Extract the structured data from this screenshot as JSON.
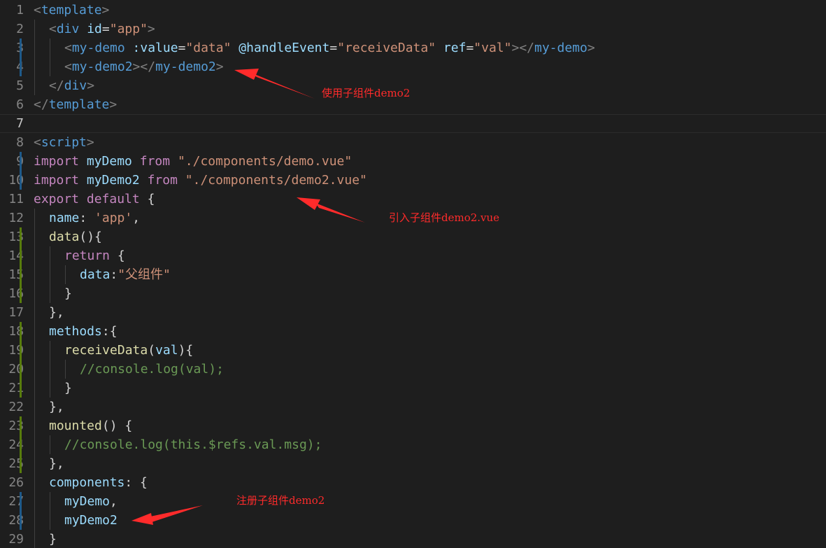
{
  "editor": {
    "background": "#1e1e1e",
    "lines": [
      {
        "n": "1",
        "indent": 0,
        "tokens": [
          [
            "t-punc",
            "<"
          ],
          [
            "t-tag",
            "template"
          ],
          [
            "t-punc",
            ">"
          ]
        ]
      },
      {
        "n": "2",
        "indent": 1,
        "tokens": [
          [
            "t-punc",
            "<"
          ],
          [
            "t-tag",
            "div"
          ],
          [
            "t-txt",
            " "
          ],
          [
            "t-attr",
            "id"
          ],
          [
            "t-txt",
            "="
          ],
          [
            "t-str",
            "\"app\""
          ],
          [
            "t-punc",
            ">"
          ]
        ]
      },
      {
        "n": "3",
        "indent": 2,
        "mark": "#1e5a8a",
        "tokens": [
          [
            "t-punc",
            "<"
          ],
          [
            "t-tag",
            "my-demo"
          ],
          [
            "t-txt",
            " "
          ],
          [
            "t-attr",
            ":value"
          ],
          [
            "t-txt",
            "="
          ],
          [
            "t-str",
            "\"data\""
          ],
          [
            "t-txt",
            " "
          ],
          [
            "t-attr",
            "@handleEvent"
          ],
          [
            "t-txt",
            "="
          ],
          [
            "t-str",
            "\"receiveData\""
          ],
          [
            "t-txt",
            " "
          ],
          [
            "t-attr",
            "ref"
          ],
          [
            "t-txt",
            "="
          ],
          [
            "t-str",
            "\"val\""
          ],
          [
            "t-punc",
            ">"
          ],
          [
            "t-punc",
            "</"
          ],
          [
            "t-tag",
            "my-demo"
          ],
          [
            "t-punc",
            ">"
          ]
        ]
      },
      {
        "n": "4",
        "indent": 2,
        "mark": "#1e5a8a",
        "tokens": [
          [
            "t-punc",
            "<"
          ],
          [
            "t-tag",
            "my-demo2"
          ],
          [
            "t-punc",
            ">"
          ],
          [
            "t-punc",
            "</"
          ],
          [
            "t-tag",
            "my-demo2"
          ],
          [
            "t-punc",
            ">"
          ]
        ]
      },
      {
        "n": "5",
        "indent": 1,
        "tokens": [
          [
            "t-punc",
            "</"
          ],
          [
            "t-tag",
            "div"
          ],
          [
            "t-punc",
            ">"
          ]
        ]
      },
      {
        "n": "6",
        "indent": 0,
        "tokens": [
          [
            "t-punc",
            "</"
          ],
          [
            "t-tag",
            "template"
          ],
          [
            "t-punc",
            ">"
          ]
        ]
      },
      {
        "n": "7",
        "indent": 0,
        "current": true,
        "tokens": []
      },
      {
        "n": "8",
        "indent": 0,
        "tokens": [
          [
            "t-punc",
            "<"
          ],
          [
            "t-tag",
            "script"
          ],
          [
            "t-punc",
            ">"
          ]
        ]
      },
      {
        "n": "9",
        "indent": 0,
        "mark": "#1e5a8a",
        "tokens": [
          [
            "t-key",
            "import"
          ],
          [
            "t-txt",
            " "
          ],
          [
            "t-var",
            "myDemo"
          ],
          [
            "t-txt",
            " "
          ],
          [
            "t-key",
            "from"
          ],
          [
            "t-txt",
            " "
          ],
          [
            "t-str",
            "\"./components/demo.vue\""
          ]
        ]
      },
      {
        "n": "10",
        "indent": 0,
        "mark": "#1e5a8a",
        "tokens": [
          [
            "t-key",
            "import"
          ],
          [
            "t-txt",
            " "
          ],
          [
            "t-var",
            "myDemo2"
          ],
          [
            "t-txt",
            " "
          ],
          [
            "t-key",
            "from"
          ],
          [
            "t-txt",
            " "
          ],
          [
            "t-str",
            "\"./components/demo2.vue\""
          ]
        ]
      },
      {
        "n": "11",
        "indent": 0,
        "tokens": [
          [
            "t-key",
            "export"
          ],
          [
            "t-txt",
            " "
          ],
          [
            "t-key",
            "default"
          ],
          [
            "t-txt",
            " {"
          ]
        ]
      },
      {
        "n": "12",
        "indent": 1,
        "tokens": [
          [
            "t-var",
            "name"
          ],
          [
            "t-txt",
            ": "
          ],
          [
            "t-str",
            "'app'"
          ],
          [
            "t-txt",
            ","
          ]
        ]
      },
      {
        "n": "13",
        "indent": 1,
        "mark": "#587c0c",
        "tokens": [
          [
            "t-fn",
            "data"
          ],
          [
            "t-txt",
            "(){"
          ]
        ]
      },
      {
        "n": "14",
        "indent": 2,
        "mark": "#587c0c",
        "tokens": [
          [
            "t-key",
            "return"
          ],
          [
            "t-txt",
            " {"
          ]
        ]
      },
      {
        "n": "15",
        "indent": 3,
        "mark": "#587c0c",
        "tokens": [
          [
            "t-var",
            "data"
          ],
          [
            "t-txt",
            ":"
          ],
          [
            "t-str",
            "\"父组件\""
          ]
        ]
      },
      {
        "n": "16",
        "indent": 2,
        "mark": "#587c0c",
        "tokens": [
          [
            "t-txt",
            "}"
          ]
        ]
      },
      {
        "n": "17",
        "indent": 1,
        "tokens": [
          [
            "t-txt",
            "},"
          ]
        ]
      },
      {
        "n": "18",
        "indent": 1,
        "mark": "#587c0c",
        "tokens": [
          [
            "t-var",
            "methods"
          ],
          [
            "t-txt",
            ":{"
          ]
        ]
      },
      {
        "n": "19",
        "indent": 2,
        "mark": "#587c0c",
        "tokens": [
          [
            "t-fn",
            "receiveData"
          ],
          [
            "t-txt",
            "("
          ],
          [
            "t-var",
            "val"
          ],
          [
            "t-txt",
            "){"
          ]
        ]
      },
      {
        "n": "20",
        "indent": 3,
        "mark": "#587c0c",
        "tokens": [
          [
            "t-com",
            "//console.log(val);"
          ]
        ]
      },
      {
        "n": "21",
        "indent": 2,
        "mark": "#587c0c",
        "tokens": [
          [
            "t-txt",
            "}"
          ]
        ]
      },
      {
        "n": "22",
        "indent": 1,
        "tokens": [
          [
            "t-txt",
            "},"
          ]
        ]
      },
      {
        "n": "23",
        "indent": 1,
        "mark": "#587c0c",
        "tokens": [
          [
            "t-fn",
            "mounted"
          ],
          [
            "t-txt",
            "() {"
          ]
        ]
      },
      {
        "n": "24",
        "indent": 2,
        "mark": "#587c0c",
        "tokens": [
          [
            "t-com",
            "//console.log(this.$refs.val.msg);"
          ]
        ]
      },
      {
        "n": "25",
        "indent": 1,
        "mark": "#587c0c",
        "tokens": [
          [
            "t-txt",
            "},"
          ]
        ]
      },
      {
        "n": "26",
        "indent": 1,
        "tokens": [
          [
            "t-var",
            "components"
          ],
          [
            "t-txt",
            ": {"
          ]
        ]
      },
      {
        "n": "27",
        "indent": 2,
        "mark": "#1e5a8a",
        "tokens": [
          [
            "t-var",
            "myDemo"
          ],
          [
            "t-txt",
            ","
          ]
        ]
      },
      {
        "n": "28",
        "indent": 2,
        "mark": "#1e5a8a",
        "tokens": [
          [
            "t-var",
            "myDemo2"
          ]
        ]
      },
      {
        "n": "29",
        "indent": 1,
        "tokens": [
          [
            "t-txt",
            "}"
          ]
        ]
      }
    ]
  },
  "annotations": {
    "color": "#ff2b2b",
    "note1": "使用子组件demo2",
    "note2": "引入子组件demo2.vue",
    "note3": "注册子组件demo2"
  }
}
